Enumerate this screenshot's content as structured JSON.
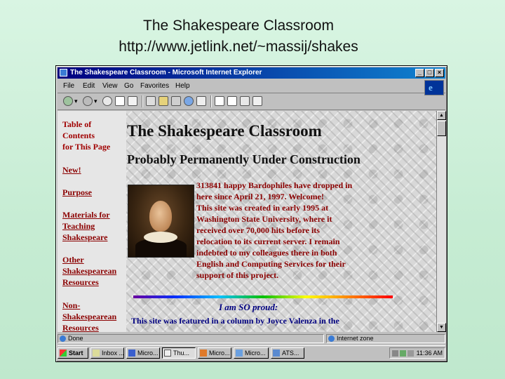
{
  "slide": {
    "title": "The Shakespeare Classroom",
    "url": "http://www.jetlink.net/~massij/shakes"
  },
  "window": {
    "title": "The Shakespeare Classroom - Microsoft Internet Explorer",
    "buttons": {
      "minimize": "_",
      "maximize": "□",
      "close": "×"
    }
  },
  "menu": [
    "File",
    "Edit",
    "View",
    "Go",
    "Favorites",
    "Help"
  ],
  "toolbar": {
    "buttons": [
      "back-icon",
      "forward-icon",
      "stop-icon",
      "refresh-icon",
      "home-icon",
      "search-icon",
      "favorites-icon",
      "history-icon",
      "channels-icon",
      "fullscreen-icon",
      "mail-icon",
      "print-icon",
      "edit-icon"
    ]
  },
  "page": {
    "nav": [
      {
        "label": "Table of\nContents\nfor This Page"
      },
      {
        "label": "New!"
      },
      {
        "label": "Purpose"
      },
      {
        "label": "Materials for\nTeaching\nShakespeare"
      },
      {
        "label": "Other\nShakespearean\nResources"
      },
      {
        "label": "Non-\nShakespearean\nResources"
      }
    ],
    "heading": "The Shakespeare Classroom",
    "subheading": "Probably Permanently Under Construction",
    "intro_lines": [
      "313841 happy Bardophiles have dropped in",
      "here since April 21, 1997. Welcome!",
      "This site was created in early 1995 at",
      "Washington State University, where it",
      "received over 70,000 hits before its",
      "relocation to its current server. I remain",
      "indebted to my colleagues there in both",
      "English and Computing Services for their",
      "support of this project."
    ],
    "proud": "I am SO proud:",
    "featured": "This site was featured in a column by Joyce Valenza in the"
  },
  "status": {
    "left": "Done",
    "zone": "Internet zone"
  },
  "taskbar": {
    "start": "Start",
    "tasks": [
      "Inbox ...",
      "Micro...",
      "Thu...",
      "Micro...",
      "Micro...",
      "ATS..."
    ],
    "clock": "11:36 AM"
  },
  "colors": {
    "title_bar": "#000080",
    "nav_link": "#8b0000",
    "proud_text": "#000080"
  }
}
